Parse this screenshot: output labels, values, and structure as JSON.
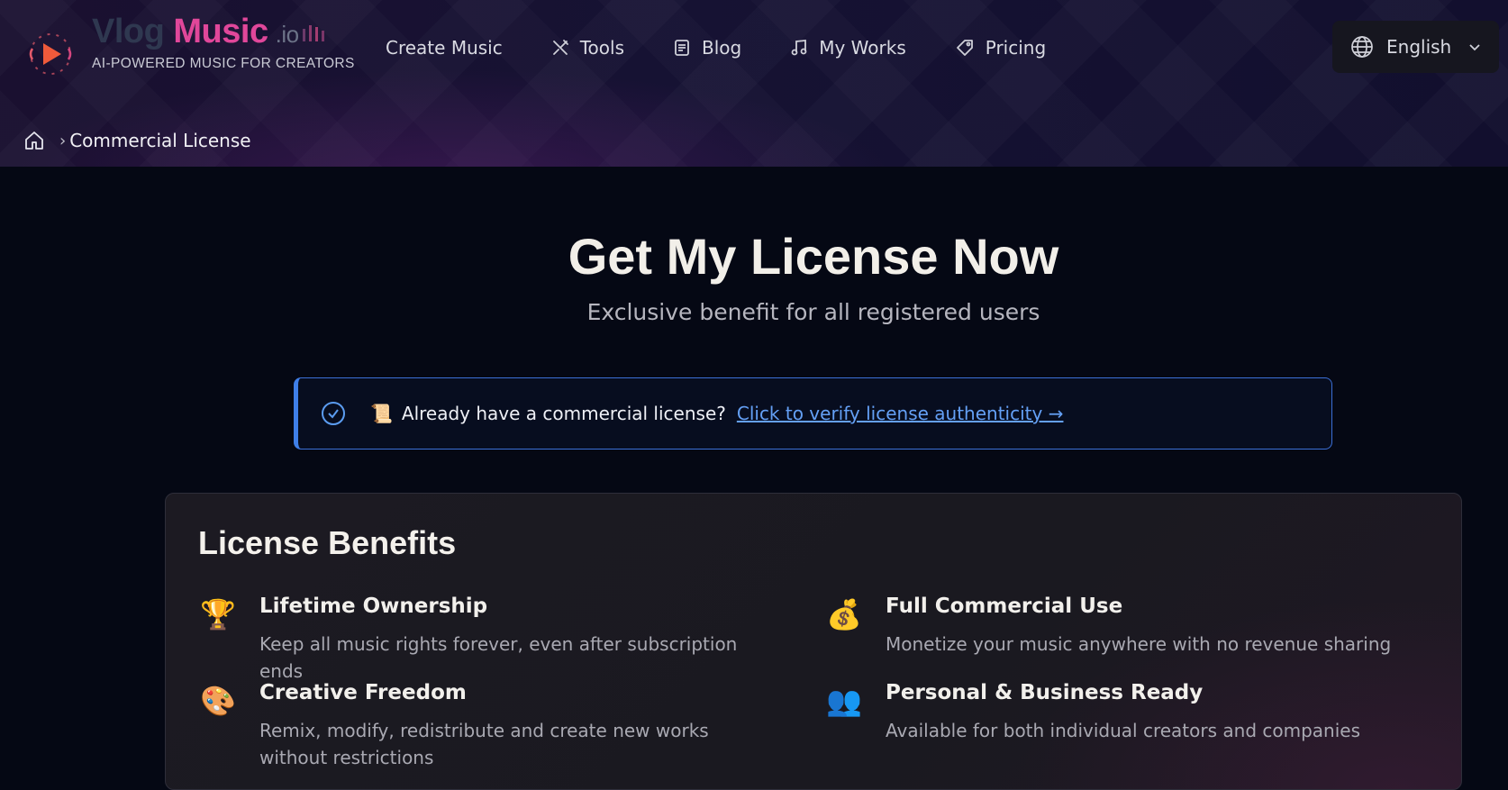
{
  "logo": {
    "word_vlog": "Vlog",
    "word_music": "Music",
    "word_io": ".io",
    "tagline": "AI-POWERED MUSIC FOR CREATORS"
  },
  "nav": {
    "items": [
      {
        "label": "Create Music",
        "icon": "none"
      },
      {
        "label": "Tools",
        "icon": "tools-icon"
      },
      {
        "label": "Blog",
        "icon": "document-icon"
      },
      {
        "label": "My Works",
        "icon": "music-note-icon"
      },
      {
        "label": "Pricing",
        "icon": "tag-icon"
      }
    ]
  },
  "language": {
    "selected": "English",
    "icon": "globe-icon"
  },
  "breadcrumb": {
    "home_icon": "home-icon",
    "current": "Commercial License"
  },
  "hero": {
    "title": "Get My License Now",
    "subtitle": "Exclusive benefit for all registered users"
  },
  "verify": {
    "emoji": "📜",
    "question": "Already have a commercial license?",
    "link": "Click to verify license authenticity →"
  },
  "benefits": {
    "title": "License Benefits",
    "items": [
      {
        "emoji": "🏆",
        "title": "Lifetime Ownership",
        "desc": "Keep all music rights forever, even after subscription ends"
      },
      {
        "emoji": "💰",
        "title": "Full Commercial Use",
        "desc": "Monetize your music anywhere with no revenue sharing"
      },
      {
        "emoji": "🎨",
        "title": "Creative Freedom",
        "desc": "Remix, modify, redistribute and create new works without restrictions"
      },
      {
        "emoji": "👥",
        "title": "Personal & Business Ready",
        "desc": "Available for both individual creators and companies"
      }
    ]
  },
  "colors": {
    "accent_pink": "#e0479a",
    "link_blue": "#64a0f5",
    "verify_border": "#3f7fe8"
  }
}
